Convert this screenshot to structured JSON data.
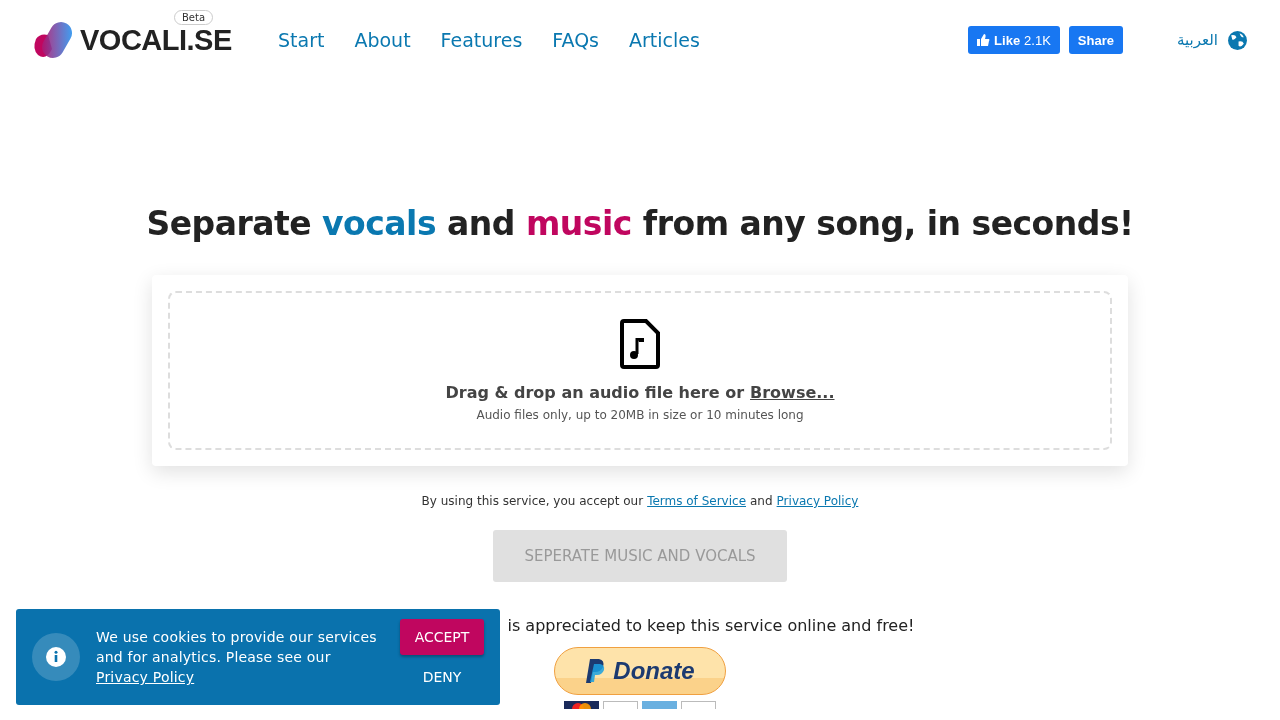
{
  "header": {
    "logo": "VOCALI.SE",
    "badge": "Beta",
    "nav": [
      {
        "label": "Start"
      },
      {
        "label": "About"
      },
      {
        "label": "Features"
      },
      {
        "label": "FAQs"
      },
      {
        "label": "Articles"
      }
    ],
    "like_button": {
      "label": "Like",
      "count": "2.1K"
    },
    "share_button": "Share",
    "language": "العربية"
  },
  "hero": {
    "parts": [
      {
        "text": "Separate ",
        "kind": "plain"
      },
      {
        "text": "vocals",
        "kind": "blue"
      },
      {
        "text": " and ",
        "kind": "plain"
      },
      {
        "text": "music",
        "kind": "pink"
      },
      {
        "text": " from any song, in seconds!",
        "kind": "plain"
      }
    ]
  },
  "dropzone": {
    "prompt": "Drag & drop an audio file here or",
    "browse": "Browse...",
    "hint": "Audio files only, up to 20MB in size or 10 minutes long"
  },
  "terms": {
    "before": "By using this service, you accept our",
    "terms_link": "Terms of Service",
    "middle": "and",
    "privacy_link": "Privacy Policy"
  },
  "submit_button": {
    "label": "SEPERATE MUSIC AND VOCALS",
    "disabled": true
  },
  "donation": {
    "text": "is appreciated to keep this service online and free!",
    "button": "Donate"
  },
  "cookie_banner": {
    "text": "We use cookies to provide our services and for analytics. Please see our",
    "link": "Privacy Policy",
    "accept": "ACCEPT",
    "deny": "DENY"
  }
}
